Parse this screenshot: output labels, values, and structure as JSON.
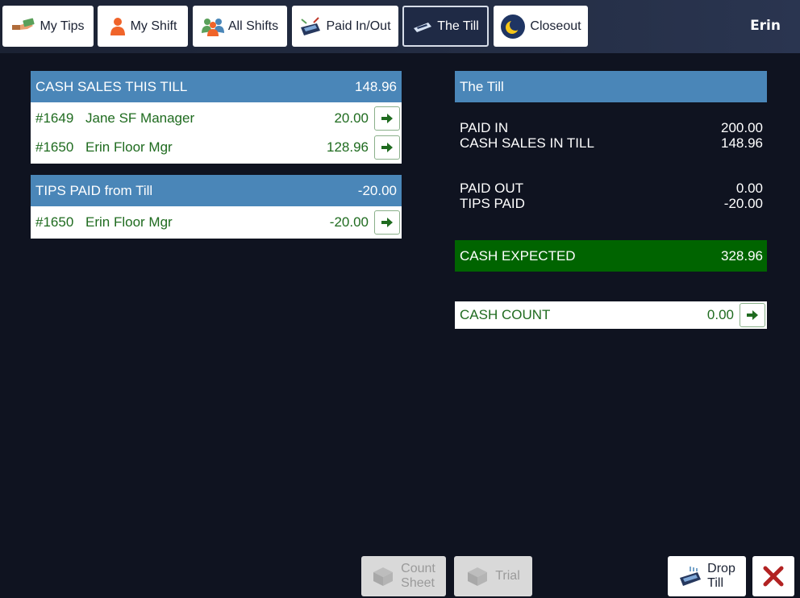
{
  "nav": {
    "tabs": [
      {
        "label": "My Tips",
        "icon": "tips-hand-icon"
      },
      {
        "label": "My Shift",
        "icon": "person-icon"
      },
      {
        "label": "All Shifts",
        "icon": "group-icon"
      },
      {
        "label": "Paid In/Out",
        "icon": "register-arrows-icon"
      },
      {
        "label": "The Till",
        "icon": "till-icon"
      },
      {
        "label": "Closeout",
        "icon": "moon-icon"
      }
    ],
    "active": "The Till",
    "user": "Erin"
  },
  "cash_sales": {
    "title": "CASH SALES THIS TILL",
    "total": "148.96",
    "rows": [
      {
        "num": "#1649",
        "name": "Jane SF Manager",
        "amount": "20.00"
      },
      {
        "num": "#1650",
        "name": "Erin Floor Mgr",
        "amount": "128.96"
      }
    ]
  },
  "tips_paid": {
    "title": "TIPS PAID from Till",
    "total": "-20.00",
    "rows": [
      {
        "num": "#1650",
        "name": "Erin Floor Mgr",
        "amount": "-20.00"
      }
    ]
  },
  "till": {
    "title": "The Till",
    "paid_in_label": "PAID IN",
    "paid_in": "200.00",
    "cash_sales_label": "CASH SALES IN TILL",
    "cash_sales": "148.96",
    "paid_out_label": "PAID OUT",
    "paid_out": "0.00",
    "tips_paid_label": "TIPS PAID",
    "tips_paid": "-20.00",
    "expected_label": "CASH EXPECTED",
    "expected": "328.96",
    "count_label": "CASH COUNT",
    "count": "0.00"
  },
  "footer": {
    "count_sheet_line1": "Count",
    "count_sheet_line2": "Sheet",
    "trial": "Trial",
    "drop_till_line1": "Drop",
    "drop_till_line2": "Till"
  },
  "colors": {
    "header_blue": "#4a86b8",
    "expected_green": "#006400",
    "row_text_green": "#1f6b1f",
    "close_red": "#b22222"
  }
}
